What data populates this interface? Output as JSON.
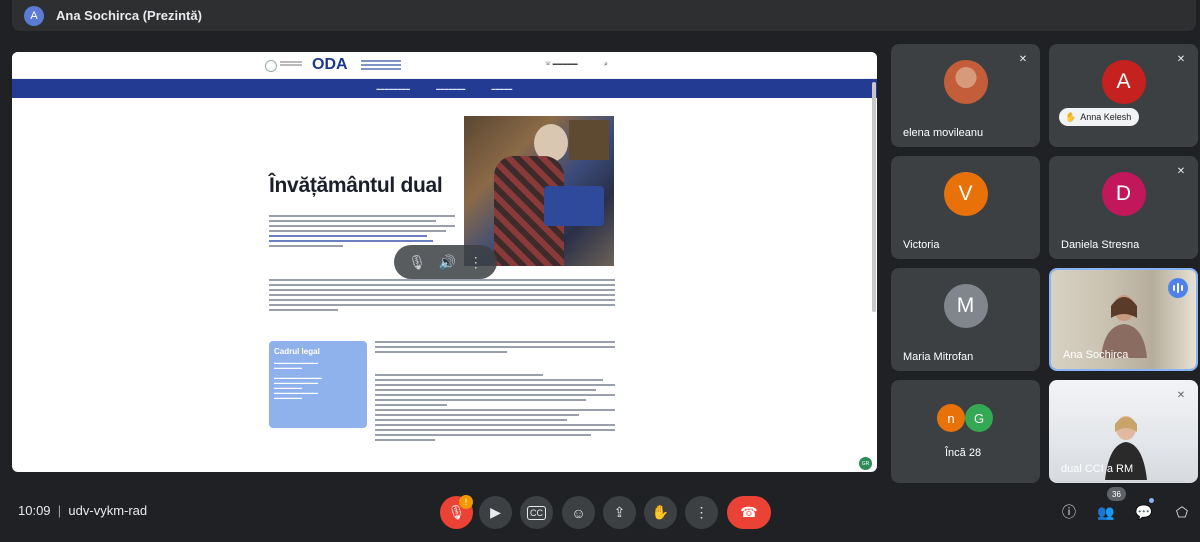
{
  "header": {
    "avatar_letter": "A",
    "presenter_label": "Ana Sochirca (Prezintă)"
  },
  "presentation": {
    "site_logo": "ODA",
    "heading": "Învățământul dual",
    "legal_box_title": "Cadrul legal",
    "badge": "GR"
  },
  "participants": [
    {
      "name": "elena movileanu",
      "type": "photo"
    },
    {
      "name": "Anna Kelesh",
      "letter": "A",
      "color": "#c5221f",
      "hand_raised": true
    },
    {
      "name": "Victoria",
      "letter": "V",
      "color": "#e8710a"
    },
    {
      "name": "Daniela Stresna",
      "letter": "D",
      "color": "#c2185b"
    },
    {
      "name": "Maria Mitrofan",
      "letter": "M",
      "color": "#80868b"
    },
    {
      "name": "Ana Sochirca",
      "type": "video",
      "speaking": true
    },
    {
      "name": "Încă 28",
      "letters": [
        "n",
        "G"
      ],
      "colors": [
        "#e8710a",
        "#34a853"
      ]
    },
    {
      "name": "dual CCI a RM",
      "type": "video"
    }
  ],
  "bottom_bar": {
    "time": "10:09",
    "separator": "|",
    "meeting_code": "udv-vykm-rad",
    "mic_badge": "!",
    "people_count": "36"
  }
}
